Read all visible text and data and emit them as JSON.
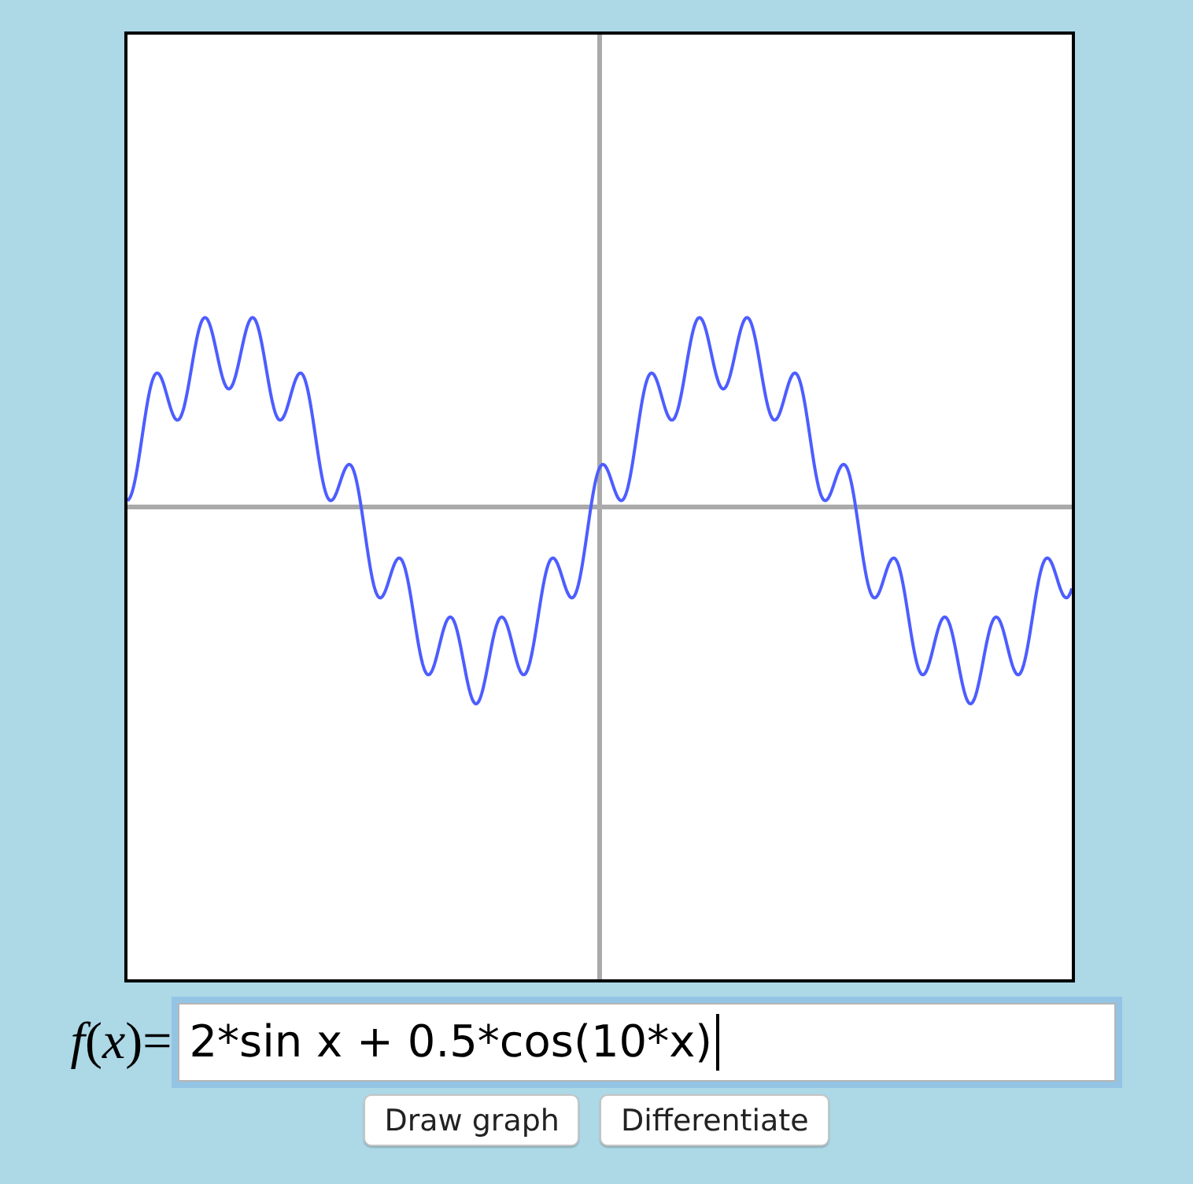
{
  "formula": {
    "label": "*f*(*x*)=",
    "value": "2*sin x + 0.5*cos(10*x)",
    "focused": true
  },
  "buttons": [
    "Draw graph",
    "Differentiate"
  ]
}
